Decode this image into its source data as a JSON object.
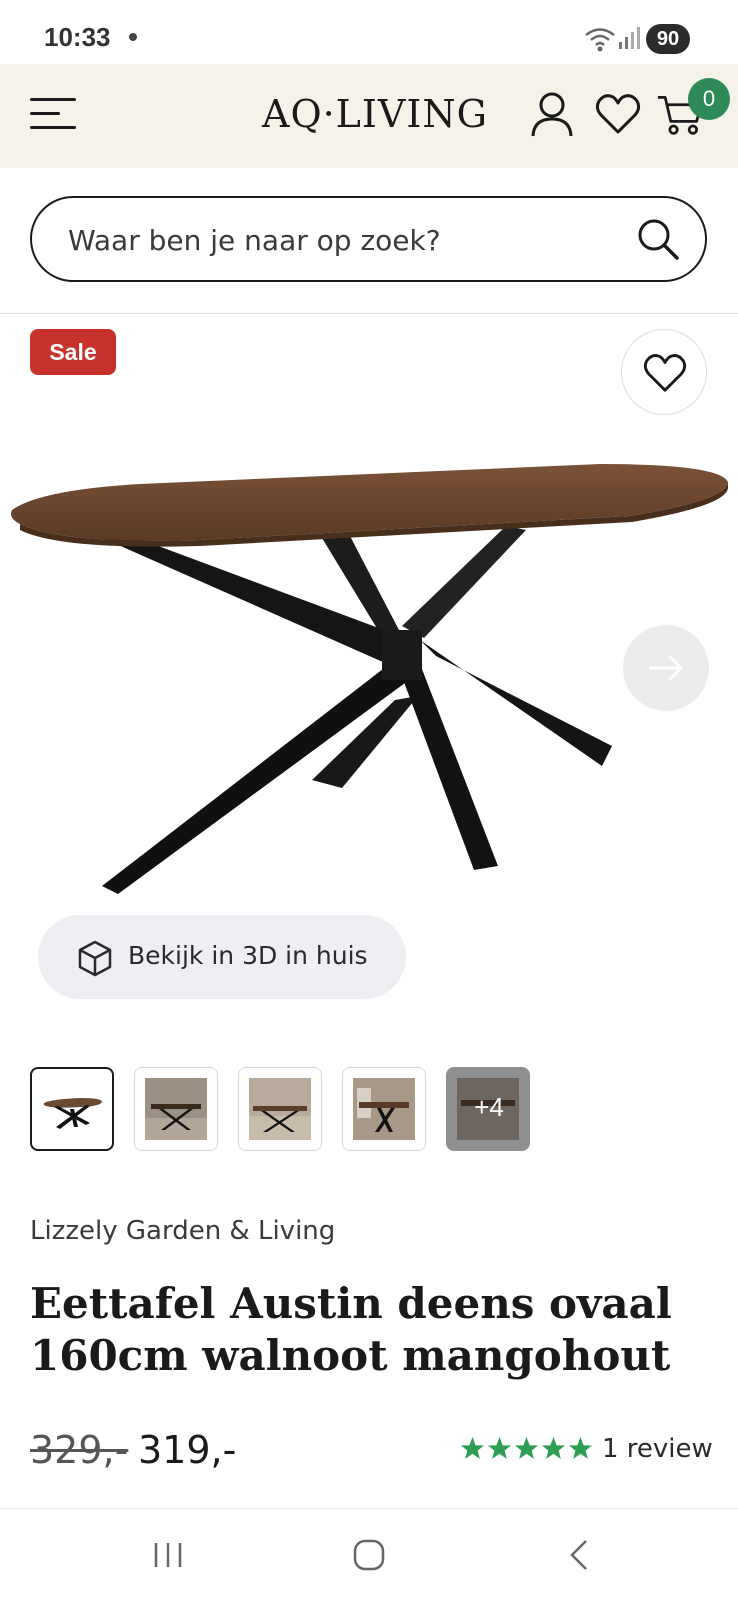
{
  "status_bar": {
    "time": "10:33",
    "battery": "90"
  },
  "header": {
    "logo": "AQ·LIVING",
    "cart_count": "0"
  },
  "search": {
    "placeholder": "Waar ben je naar op zoek?"
  },
  "product": {
    "badge": "Sale",
    "view_3d_label": "Bekijk in 3D in huis",
    "thumbnails_more_label": "+4",
    "brand": "Lizzely Garden & Living",
    "title": "Eettafel Austin deens ovaal 160cm walnoot mangohout",
    "price_old": "329,-",
    "price_new": "319,-",
    "rating_stars": 5,
    "reviews": "1 review"
  },
  "colors": {
    "header_bg": "#f5f2ea",
    "sale_red": "#c8322d",
    "cart_badge_green": "#2e8b57",
    "star_green": "#2e9e55"
  },
  "icons": [
    "menu-icon",
    "account-icon",
    "heart-icon",
    "cart-icon",
    "search-icon",
    "arrow-right-icon",
    "cube-3d-icon",
    "nav-recents-icon",
    "nav-home-icon",
    "nav-back-icon"
  ]
}
